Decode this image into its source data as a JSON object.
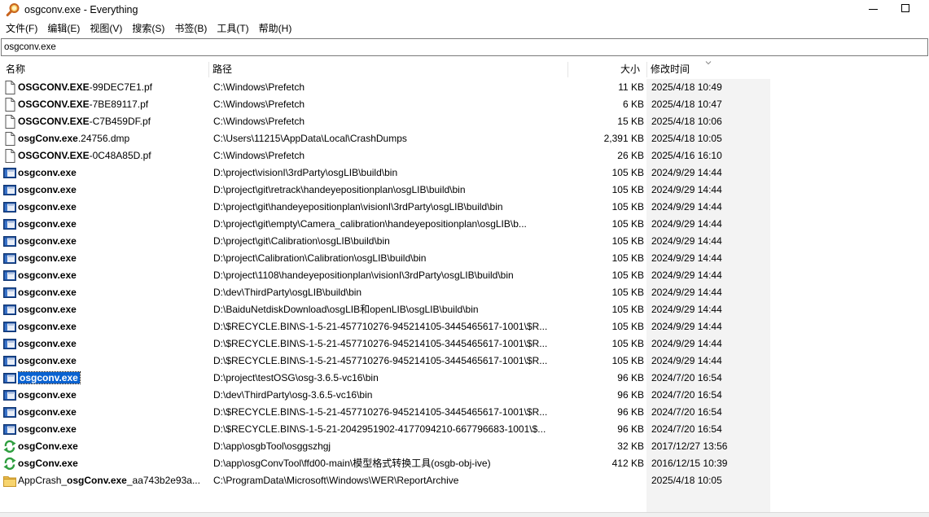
{
  "window": {
    "title": "osgconv.exe - Everything"
  },
  "menu": [
    "文件(F)",
    "编辑(E)",
    "视图(V)",
    "搜索(S)",
    "书签(B)",
    "工具(T)",
    "帮助(H)"
  ],
  "search": {
    "value": "osgconv.exe"
  },
  "columns": {
    "name": "名称",
    "path": "路径",
    "size": "大小",
    "date": "修改时间"
  },
  "sort": {
    "column": "date",
    "direction": "descending"
  },
  "rows": [
    {
      "icon": "file-icon",
      "name_bold": "OSGCONV.EXE",
      "name_rest": "-99DEC7E1.pf",
      "path": "C:\\Windows\\Prefetch",
      "size": "11 KB",
      "date": "2025/4/18 10:49"
    },
    {
      "icon": "file-icon",
      "name_bold": "OSGCONV.EXE",
      "name_rest": "-7BE89117.pf",
      "path": "C:\\Windows\\Prefetch",
      "size": "6 KB",
      "date": "2025/4/18 10:47"
    },
    {
      "icon": "file-icon",
      "name_bold": "OSGCONV.EXE",
      "name_rest": "-C7B459DF.pf",
      "path": "C:\\Windows\\Prefetch",
      "size": "15 KB",
      "date": "2025/4/18 10:06"
    },
    {
      "icon": "file-icon",
      "name_bold": "osgConv.exe",
      "name_rest": ".24756.dmp",
      "path": "C:\\Users\\11215\\AppData\\Local\\CrashDumps",
      "size": "2,391 KB",
      "date": "2025/4/18 10:05"
    },
    {
      "icon": "file-icon",
      "name_bold": "OSGCONV.EXE",
      "name_rest": "-0C48A85D.pf",
      "path": "C:\\Windows\\Prefetch",
      "size": "26 KB",
      "date": "2025/4/16 16:10"
    },
    {
      "icon": "exe-icon",
      "name_bold": "osgconv.exe",
      "name_rest": "",
      "path": "D:\\project\\visionI\\3rdParty\\osgLIB\\build\\bin",
      "size": "105 KB",
      "date": "2024/9/29 14:44"
    },
    {
      "icon": "exe-icon",
      "name_bold": "osgconv.exe",
      "name_rest": "",
      "path": "D:\\project\\git\\retrack\\handeyepositionplan\\osgLIB\\build\\bin",
      "size": "105 KB",
      "date": "2024/9/29 14:44"
    },
    {
      "icon": "exe-icon",
      "name_bold": "osgconv.exe",
      "name_rest": "",
      "path": "D:\\project\\git\\handeyepositionplan\\visionI\\3rdParty\\osgLIB\\build\\bin",
      "size": "105 KB",
      "date": "2024/9/29 14:44"
    },
    {
      "icon": "exe-icon",
      "name_bold": "osgconv.exe",
      "name_rest": "",
      "path": "D:\\project\\git\\empty\\Camera_calibration\\handeyepositionplan\\osgLIB\\b...",
      "size": "105 KB",
      "date": "2024/9/29 14:44"
    },
    {
      "icon": "exe-icon",
      "name_bold": "osgconv.exe",
      "name_rest": "",
      "path": "D:\\project\\git\\Calibration\\osgLIB\\build\\bin",
      "size": "105 KB",
      "date": "2024/9/29 14:44"
    },
    {
      "icon": "exe-icon",
      "name_bold": "osgconv.exe",
      "name_rest": "",
      "path": "D:\\project\\Calibration\\Calibration\\osgLIB\\build\\bin",
      "size": "105 KB",
      "date": "2024/9/29 14:44"
    },
    {
      "icon": "exe-icon",
      "name_bold": "osgconv.exe",
      "name_rest": "",
      "path": "D:\\project\\1108\\handeyepositionplan\\visionI\\3rdParty\\osgLIB\\build\\bin",
      "size": "105 KB",
      "date": "2024/9/29 14:44"
    },
    {
      "icon": "exe-icon",
      "name_bold": "osgconv.exe",
      "name_rest": "",
      "path": "D:\\dev\\ThirdParty\\osgLIB\\build\\bin",
      "size": "105 KB",
      "date": "2024/9/29 14:44"
    },
    {
      "icon": "exe-icon",
      "name_bold": "osgconv.exe",
      "name_rest": "",
      "path": "D:\\BaiduNetdiskDownload\\osgLIB和openLIB\\osgLIB\\build\\bin",
      "size": "105 KB",
      "date": "2024/9/29 14:44"
    },
    {
      "icon": "exe-icon",
      "name_bold": "osgconv.exe",
      "name_rest": "",
      "path": "D:\\$RECYCLE.BIN\\S-1-5-21-457710276-945214105-3445465617-1001\\$R...",
      "size": "105 KB",
      "date": "2024/9/29 14:44"
    },
    {
      "icon": "exe-icon",
      "name_bold": "osgconv.exe",
      "name_rest": "",
      "path": "D:\\$RECYCLE.BIN\\S-1-5-21-457710276-945214105-3445465617-1001\\$R...",
      "size": "105 KB",
      "date": "2024/9/29 14:44"
    },
    {
      "icon": "exe-icon",
      "name_bold": "osgconv.exe",
      "name_rest": "",
      "path": "D:\\$RECYCLE.BIN\\S-1-5-21-457710276-945214105-3445465617-1001\\$R...",
      "size": "105 KB",
      "date": "2024/9/29 14:44"
    },
    {
      "icon": "exe-icon",
      "name_bold": "osgconv.exe",
      "name_rest": "",
      "path": "D:\\project\\testOSG\\osg-3.6.5-vc16\\bin",
      "size": "96 KB",
      "date": "2024/7/20 16:54",
      "selected": true
    },
    {
      "icon": "exe-icon",
      "name_bold": "osgconv.exe",
      "name_rest": "",
      "path": "D:\\dev\\ThirdParty\\osg-3.6.5-vc16\\bin",
      "size": "96 KB",
      "date": "2024/7/20 16:54"
    },
    {
      "icon": "exe-icon",
      "name_bold": "osgconv.exe",
      "name_rest": "",
      "path": "D:\\$RECYCLE.BIN\\S-1-5-21-457710276-945214105-3445465617-1001\\$R...",
      "size": "96 KB",
      "date": "2024/7/20 16:54"
    },
    {
      "icon": "exe-icon",
      "name_bold": "osgconv.exe",
      "name_rest": "",
      "path": "D:\\$RECYCLE.BIN\\S-1-5-21-2042951902-4177094210-667796683-1001\\$...",
      "size": "96 KB",
      "date": "2024/7/20 16:54"
    },
    {
      "icon": "sync-icon",
      "name_bold": "osgConv.exe",
      "name_rest": "",
      "path": "D:\\app\\osgbTool\\osggszhgj",
      "size": "32 KB",
      "date": "2017/12/27 13:56"
    },
    {
      "icon": "sync-icon",
      "name_bold": "osgConv.exe",
      "name_rest": "",
      "path": "D:\\app\\osgConvTool\\ffd00-main\\模型格式转换工具(osgb-obj-ive)",
      "size": "412 KB",
      "date": "2016/12/15 10:39"
    },
    {
      "icon": "folder-icon",
      "name_pre": "AppCrash_",
      "name_bold": "osgConv.exe",
      "name_rest": "_aa743b2e93a...",
      "path": "C:\\ProgramData\\Microsoft\\Windows\\WER\\ReportArchive",
      "size": "",
      "date": "2025/4/18 10:05"
    }
  ]
}
